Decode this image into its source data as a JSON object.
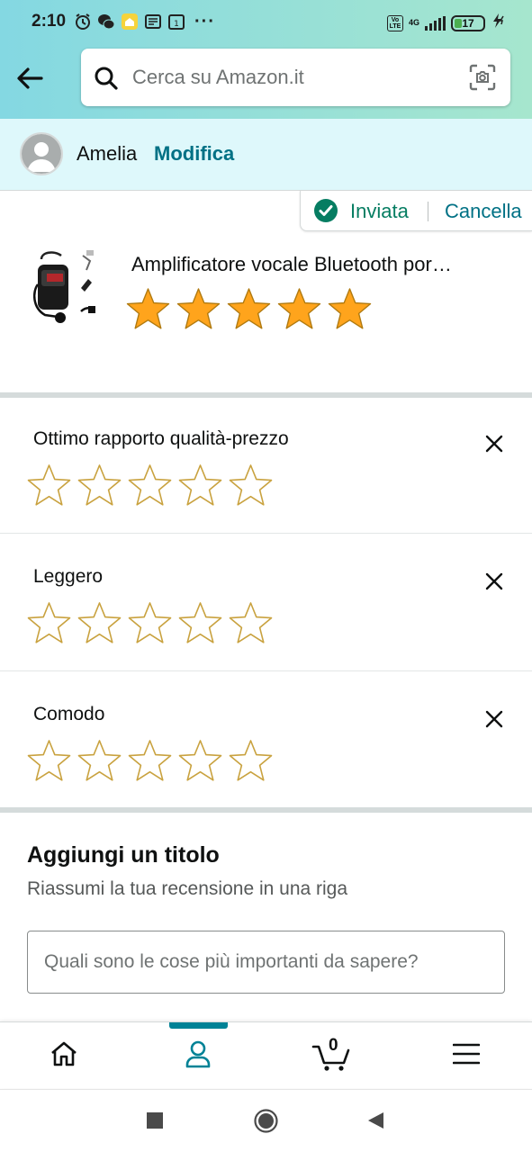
{
  "status_bar": {
    "time": "2:10",
    "signal_label": "4G",
    "battery": "17"
  },
  "search": {
    "placeholder": "Cerca su Amazon.it"
  },
  "user": {
    "name": "Amelia",
    "edit_label": "Modifica"
  },
  "review_status": {
    "sent_label": "Inviata",
    "cancel_label": "Cancella"
  },
  "product": {
    "title": "Amplificatore vocale Bluetooth por…",
    "overall_rating": 5,
    "max_rating": 5
  },
  "attributes": [
    {
      "label": "Ottimo rapporto qualità-prezzo",
      "rating": 0
    },
    {
      "label": "Leggero",
      "rating": 0
    },
    {
      "label": "Comodo",
      "rating": 0
    }
  ],
  "title_section": {
    "heading": "Aggiungi un titolo",
    "subtitle": "Riassumi la tua recensione in una riga",
    "input_placeholder": "Quali sono le cose più importanti da sapere?"
  },
  "bottom_nav": {
    "items": [
      "home-icon",
      "account-icon",
      "cart-icon",
      "menu-icon"
    ],
    "active": "account-icon",
    "cart_count": "0"
  },
  "colors": {
    "accent": "#007185",
    "star_fill": "#ffa41c",
    "star_outline": "#c9a23f",
    "success": "#067d62"
  }
}
